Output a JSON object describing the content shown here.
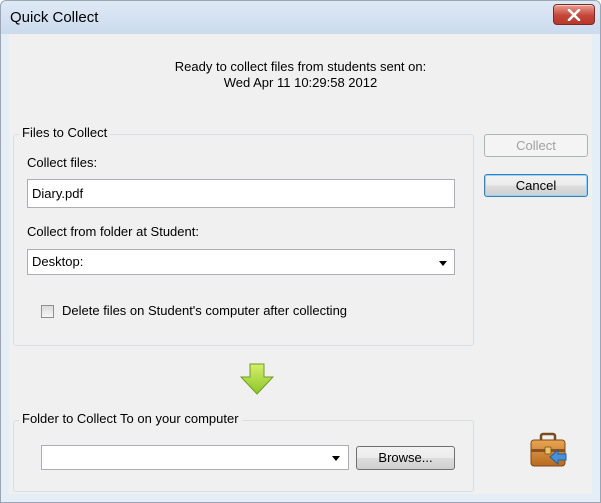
{
  "window": {
    "title": "Quick Collect"
  },
  "header": {
    "ready_line1": "Ready to collect files from students sent on:",
    "ready_line2": "Wed Apr 11 10:29:58 2012"
  },
  "files_group": {
    "legend": "Files to Collect",
    "collect_files_label": "Collect files:",
    "collect_files_value": "Diary.pdf",
    "folder_label": "Collect from folder at Student:",
    "folder_selected": "Desktop:",
    "delete_label": "Delete files on Student's computer after collecting",
    "delete_checked": false
  },
  "dest_group": {
    "legend": "Folder to Collect To on your computer",
    "folder_value": "",
    "browse_label": "Browse..."
  },
  "actions": {
    "collect_label": "Collect",
    "cancel_label": "Cancel"
  },
  "icons": {
    "arrow": "down-arrow-icon",
    "briefcase": "briefcase-icon",
    "close": "close-icon"
  },
  "colors": {
    "arrow_fill": "#9bd23a",
    "close_red": "#c7463a"
  }
}
